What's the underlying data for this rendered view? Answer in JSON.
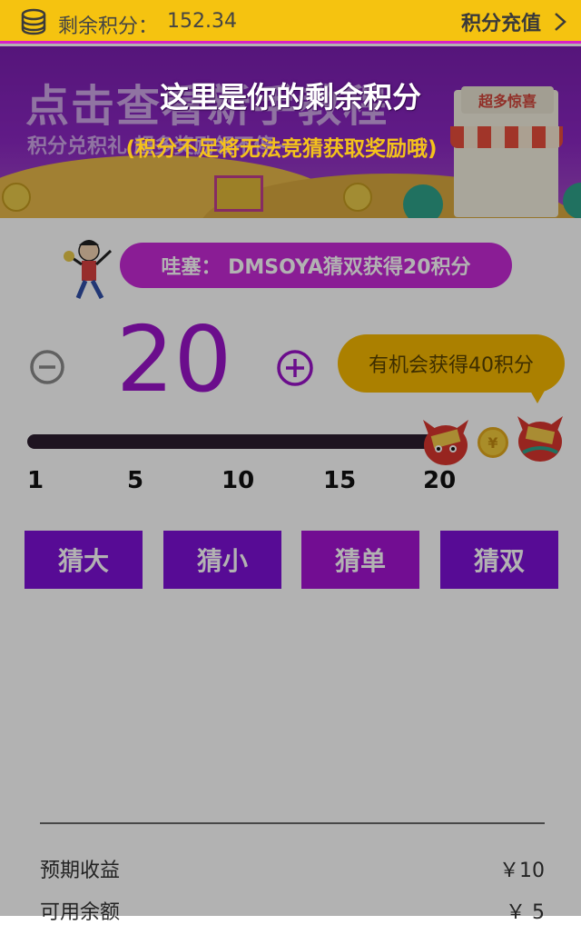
{
  "header": {
    "points_label": "剩余积分：",
    "points_value": "152.34",
    "recharge_label": "积分充值"
  },
  "banner": {
    "title": "点击查看新手教程",
    "subtitle": "积分兑积礼 超多奖励领不停~",
    "shop_sign": "超多惊喜"
  },
  "tutorial": {
    "main": "这里是你的剩余积分",
    "sub": "(积分不足将无法竞猜获取奖励哦)"
  },
  "ticker": {
    "text": "哇塞： DMSOYA猜双获得20积分"
  },
  "bet": {
    "value": "20",
    "reward_hint": "有机会获得40积分",
    "slider_value": 20,
    "slider_min": 1,
    "slider_max": 20,
    "ticks": [
      "1",
      "5",
      "10",
      "15",
      "20"
    ]
  },
  "guess_buttons": [
    {
      "label": "猜大"
    },
    {
      "label": "猜小"
    },
    {
      "label": "猜单"
    },
    {
      "label": "猜双"
    }
  ],
  "summary": {
    "expected_label": "预期收益",
    "expected_value": "￥10",
    "available_label": "可用余额",
    "available_value": "￥ 5"
  },
  "colors": {
    "topbar": "#f5c310",
    "accent_purple": "#9a13c9",
    "button_purple": "#7d10d6",
    "bubble_yellow": "#f5b800"
  },
  "icons": {
    "coin": "coin-stack-icon",
    "chevron": "chevron-right-icon",
    "minus": "minus-circle-icon",
    "plus": "plus-circle-icon"
  }
}
